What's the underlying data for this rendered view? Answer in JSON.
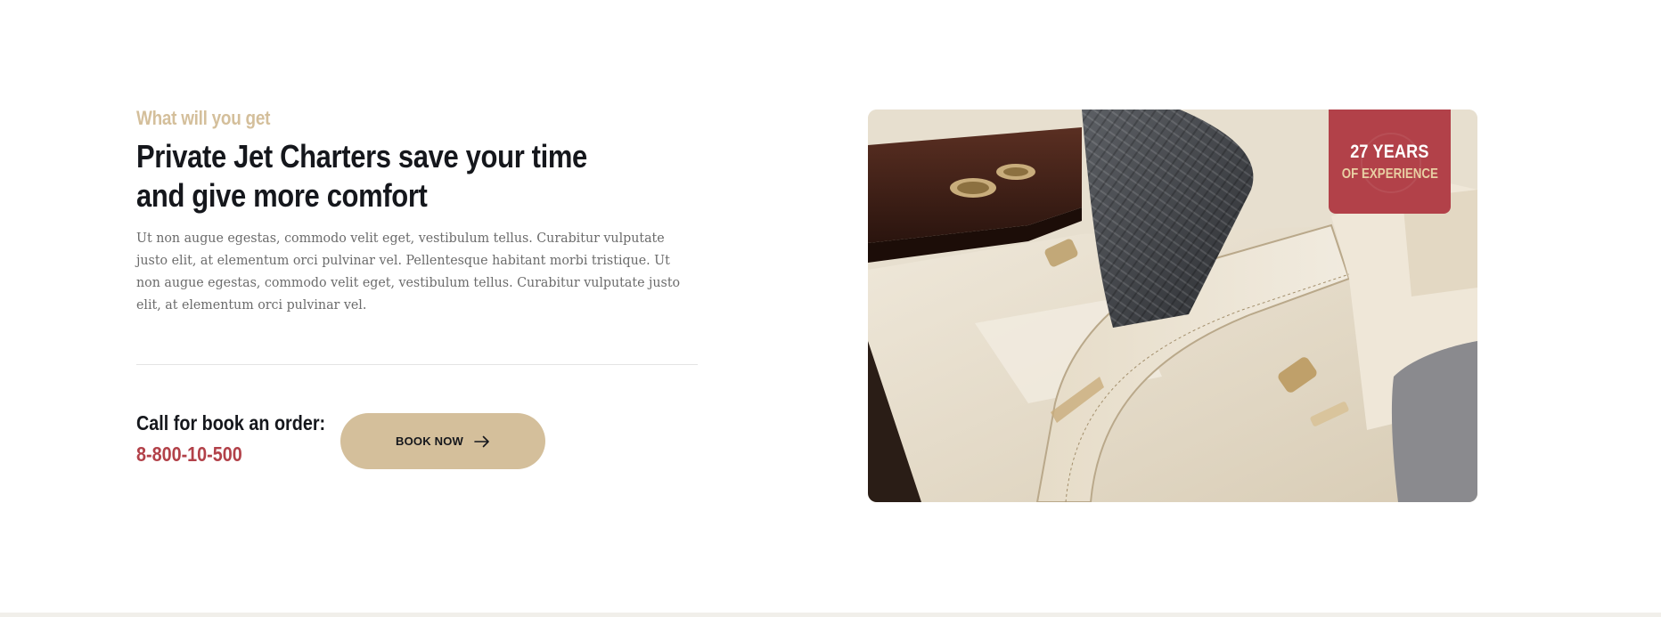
{
  "about": {
    "eyebrow": "What will you get",
    "title_line1": "Private Jet Charters save your time",
    "title_line2": "and give more comfort",
    "description": "Ut non augue egestas, commodo velit eget, vestibulum tellus. Curabitur vulputate justo elit, at elementum orci pulvinar vel. Pellentesque habitant morbi tristique. Ut non augue egestas, commodo velit eget, vestibulum tellus. Curabitur vulputate justo elit, at elementum orci pulvinar vel."
  },
  "call": {
    "label": "Call for book an order:",
    "phone": "8-800-10-500"
  },
  "book_button": {
    "label": "BOOK NOW",
    "icon": "arrow-right-icon"
  },
  "badge": {
    "line1": "27 YEARS",
    "line2": "OF EXPERIENCE"
  },
  "colors": {
    "accent_gold": "#d4bf9b",
    "accent_red": "#b24149",
    "heading": "#15171c",
    "body_text": "#6b6b6b"
  }
}
